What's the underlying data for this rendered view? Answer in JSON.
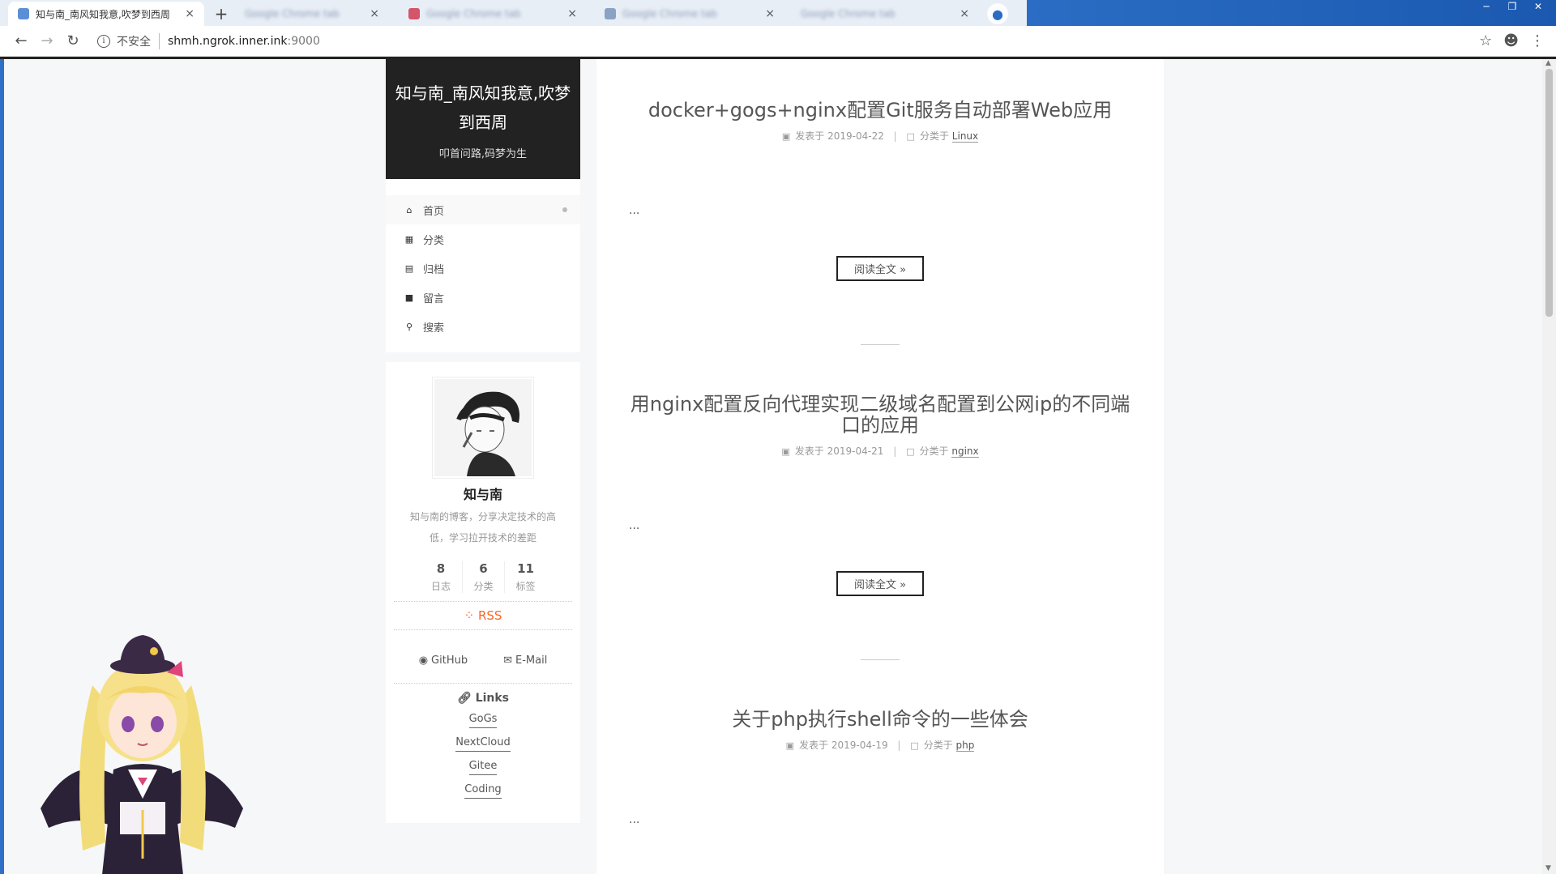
{
  "browser": {
    "active_tab": {
      "title": "知与南_南风知我意,吹梦到西周",
      "close": "×"
    },
    "background_tabs": [
      {
        "title": "Google Chrome tab",
        "close": "×"
      },
      {
        "title": "Google Chrome tab",
        "close": "×"
      },
      {
        "title": "Google Chrome tab",
        "close": "×"
      },
      {
        "title": "Google Chrome tab",
        "close": "×"
      }
    ],
    "new_tab": "+",
    "address": {
      "security_label": "不安全",
      "host": "shmh.ngrok.inner.ink",
      "port": ":9000"
    }
  },
  "sidebar": {
    "site_title": "知与南_南风知我意,吹梦到西周",
    "site_subtitle": "叩首问路,码梦为生",
    "menu": [
      {
        "label": "首页",
        "icon": "home-icon",
        "active": true
      },
      {
        "label": "分类",
        "icon": "th-icon",
        "active": false
      },
      {
        "label": "归档",
        "icon": "archive-icon",
        "active": false
      },
      {
        "label": "留言",
        "icon": "comment-icon",
        "active": false
      },
      {
        "label": "搜索",
        "icon": "search-icon",
        "active": false
      }
    ],
    "profile": {
      "author": "知与南",
      "description": "知与南的博客，分享决定技术的高低，学习拉开技术的差距",
      "stats": [
        {
          "count": "8",
          "label": "日志"
        },
        {
          "count": "6",
          "label": "分类"
        },
        {
          "count": "11",
          "label": "标签"
        }
      ],
      "rss": "RSS",
      "social": [
        {
          "label": "GitHub",
          "icon": "github-icon"
        },
        {
          "label": "E-Mail",
          "icon": "envelope-icon"
        }
      ],
      "links_title": "Links",
      "links": [
        "GoGs",
        "NextCloud",
        "Gitee",
        "Coding"
      ]
    }
  },
  "posts": [
    {
      "title": "docker+gogs+nginx配置Git服务自动部署Web应用",
      "date_label": "发表于",
      "date": "2019-04-22",
      "cat_label": "分类于",
      "category": "Linux",
      "excerpt": "...",
      "read_more": "阅读全文 »"
    },
    {
      "title": "用nginx配置反向代理实现二级域名配置到公网ip的不同端口的应用",
      "date_label": "发表于",
      "date": "2019-04-21",
      "cat_label": "分类于",
      "category": "nginx",
      "excerpt": "...",
      "read_more": "阅读全文 »"
    },
    {
      "title": "关于php执行shell命令的一些体会",
      "date_label": "发表于",
      "date": "2019-04-19",
      "cat_label": "分类于",
      "category": "php",
      "excerpt": "..."
    }
  ],
  "colors": {
    "brand_bg": "#222222",
    "rss": "#fc6423",
    "tabbar": "#1b59b0"
  }
}
